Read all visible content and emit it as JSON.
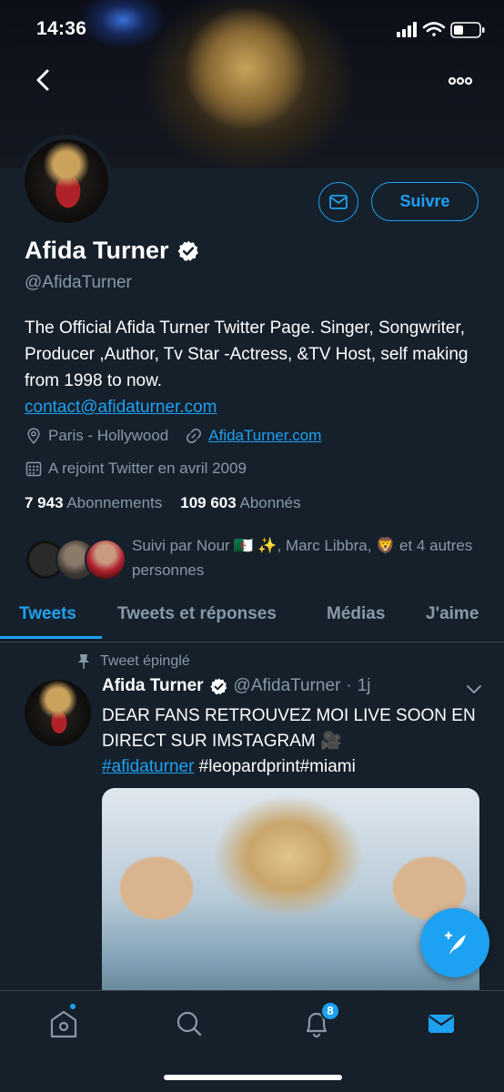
{
  "status_bar": {
    "time": "14:36"
  },
  "profile": {
    "name": "Afida Turner",
    "handle": "@AfidaTurner",
    "verified": true,
    "follow_label": "Suivre",
    "bio": "The Official Afida Turner Twitter Page. Singer, Songwriter, Producer ,Author, Tv Star -Actress, &TV Host, self making from 1998 to now.",
    "bio_email": "contact@afidaturner.com",
    "location": "Paris - Hollywood",
    "website": "AfidaTurner.com",
    "joined": "A rejoint Twitter en avril 2009",
    "following_count": "7 943",
    "following_label": "Abonnements",
    "followers_count": "109 603",
    "followers_label": "Abonnés",
    "followed_by": "Suivi par Nour 🇩🇿 ✨, Marc Libbra, 🦁 et 4 autres personnes"
  },
  "tabs": [
    {
      "label": "Tweets",
      "active": true
    },
    {
      "label": "Tweets et réponses",
      "active": false
    },
    {
      "label": "Médias",
      "active": false
    },
    {
      "label": "J'aime",
      "active": false
    }
  ],
  "tweet": {
    "pinned_label": "Tweet épinglé",
    "author_name": "Afida Turner",
    "author_handle": "@AfidaTurner",
    "separator": "·",
    "time": "1j",
    "text": "DEAR FANS RETROUVEZ MOI LIVE SOON EN DIRECT SUR IMSTAGRAM 🎥",
    "hashtag_link": "#afidaturner",
    "hashtag_rest": " #leopardprint#miami"
  },
  "bottom_nav": {
    "items": [
      "home-icon",
      "search-icon",
      "bell-icon",
      "mail-icon"
    ],
    "notification_badge": "8"
  },
  "colors": {
    "accent": "#1da1f2",
    "background": "#15202b",
    "muted": "#8899a6"
  }
}
